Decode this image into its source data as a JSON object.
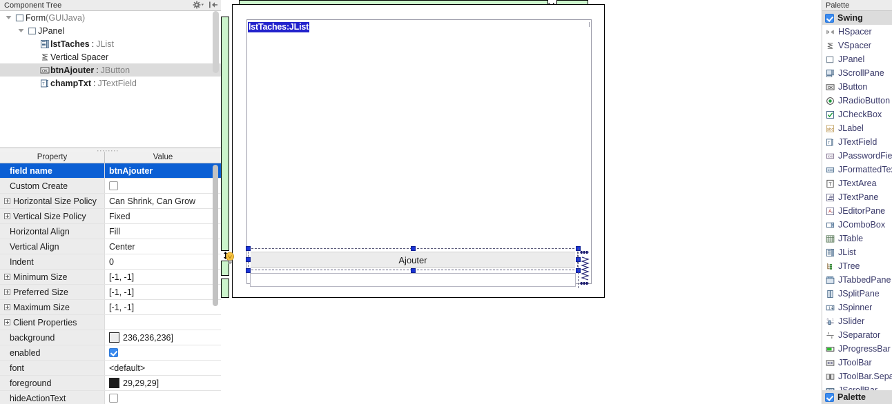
{
  "component_tree": {
    "title": "Component Tree",
    "tools": [
      {
        "name": "gear-dropdown-icon",
        "label": "Settings"
      },
      {
        "name": "collapse-all-icon",
        "label": "Collapse All"
      }
    ],
    "rows": [
      {
        "depth": 0,
        "twisty": "expanded",
        "icon": "form-icon",
        "name": "Form",
        "sep": "",
        "cls": "(GUIJava)",
        "bold": false,
        "selected": false
      },
      {
        "depth": 1,
        "twisty": "expanded",
        "icon": "jpanel-icon",
        "name": "JPanel",
        "sep": "",
        "cls": "",
        "bold": false,
        "selected": false
      },
      {
        "depth": 2,
        "twisty": "none",
        "icon": "jlist-icon",
        "name": "lstTaches",
        "sep": ":",
        "cls": "JList",
        "bold": true,
        "selected": false
      },
      {
        "depth": 2,
        "twisty": "none",
        "icon": "vspacer-icon",
        "name": "Vertical Spacer",
        "sep": "",
        "cls": "",
        "bold": false,
        "selected": false
      },
      {
        "depth": 2,
        "twisty": "none",
        "icon": "jbutton-icon",
        "name": "btnAjouter",
        "sep": ":",
        "cls": "JButton",
        "bold": true,
        "selected": true
      },
      {
        "depth": 2,
        "twisty": "none",
        "icon": "jtextfield-icon",
        "name": "champTxt",
        "sep": ":",
        "cls": "JTextField",
        "bold": true,
        "selected": false
      }
    ]
  },
  "properties": {
    "header": {
      "property": "Property",
      "value": "Value"
    },
    "rows": [
      {
        "name": "field name",
        "value": "btnAjouter",
        "kind": "text",
        "expandable": false,
        "selected": true
      },
      {
        "name": "Custom Create",
        "value": "",
        "kind": "checkbox",
        "checked": false,
        "expandable": false,
        "selected": false
      },
      {
        "name": "Horizontal Size Policy",
        "value": "Can Shrink, Can Grow",
        "kind": "text",
        "expandable": true,
        "selected": false
      },
      {
        "name": "Vertical Size Policy",
        "value": "Fixed",
        "kind": "text",
        "expandable": true,
        "selected": false
      },
      {
        "name": "Horizontal Align",
        "value": "Fill",
        "kind": "text",
        "expandable": false,
        "selected": false
      },
      {
        "name": "Vertical Align",
        "value": "Center",
        "kind": "text",
        "expandable": false,
        "selected": false
      },
      {
        "name": "Indent",
        "value": "0",
        "kind": "text",
        "expandable": false,
        "selected": false
      },
      {
        "name": "Minimum Size",
        "value": "[-1, -1]",
        "kind": "text",
        "expandable": true,
        "selected": false
      },
      {
        "name": "Preferred Size",
        "value": "[-1, -1]",
        "kind": "text",
        "expandable": true,
        "selected": false
      },
      {
        "name": "Maximum Size",
        "value": "[-1, -1]",
        "kind": "text",
        "expandable": true,
        "selected": false
      },
      {
        "name": "Client Properties",
        "value": "",
        "kind": "text",
        "expandable": true,
        "selected": false
      },
      {
        "name": "background",
        "value": "236,236,236]",
        "kind": "color",
        "swatch": "#ececec",
        "expandable": false,
        "selected": false
      },
      {
        "name": "enabled",
        "value": "",
        "kind": "checkbox",
        "checked": true,
        "expandable": false,
        "selected": false
      },
      {
        "name": "font",
        "value": "<default>",
        "kind": "text",
        "expandable": false,
        "selected": false
      },
      {
        "name": "foreground",
        "value": "29,29,29]",
        "kind": "color",
        "swatch": "#1d1d1d",
        "expandable": false,
        "selected": false
      },
      {
        "name": "hideActionText",
        "value": "",
        "kind": "checkbox",
        "checked": false,
        "expandable": false,
        "selected": false
      }
    ]
  },
  "designer": {
    "jlist_label": "lstTaches:JList",
    "button_label": "Ajouter",
    "textfield_value": "",
    "horizontal_resize_icon": "horizontal-resize-arrow-icon",
    "vertical_resize_icon": "vertical-resize-arrow-icon",
    "intention_icon": "lightbulb-icon",
    "vspacer_icon": "vertical-spacer-spring-icon",
    "colors": {
      "ruler_fill": "#ccf5cc",
      "selection_handle": "#1b34d6",
      "label_highlight": "#2222cc"
    }
  },
  "palette": {
    "title": "Palette",
    "group": {
      "label": "Swing",
      "checked": true
    },
    "items": [
      {
        "label": "HSpacer",
        "icon": "hspacer-icon"
      },
      {
        "label": "VSpacer",
        "icon": "vspacer-icon"
      },
      {
        "label": "JPanel",
        "icon": "jpanel-icon"
      },
      {
        "label": "JScrollPane",
        "icon": "jscrollpane-icon"
      },
      {
        "label": "JButton",
        "icon": "jbutton-icon"
      },
      {
        "label": "JRadioButton",
        "icon": "jradiobutton-icon"
      },
      {
        "label": "JCheckBox",
        "icon": "jcheckbox-icon"
      },
      {
        "label": "JLabel",
        "icon": "jlabel-icon"
      },
      {
        "label": "JTextField",
        "icon": "jtextfield-icon"
      },
      {
        "label": "JPasswordField",
        "icon": "jpasswordfield-icon"
      },
      {
        "label": "JFormattedTextField",
        "icon": "jformattedtextfield-icon"
      },
      {
        "label": "JTextArea",
        "icon": "jtextarea-icon"
      },
      {
        "label": "JTextPane",
        "icon": "jtextpane-icon"
      },
      {
        "label": "JEditorPane",
        "icon": "jeditorpane-icon"
      },
      {
        "label": "JComboBox",
        "icon": "jcombobox-icon"
      },
      {
        "label": "JTable",
        "icon": "jtable-icon"
      },
      {
        "label": "JList",
        "icon": "jlist-icon"
      },
      {
        "label": "JTree",
        "icon": "jtree-icon"
      },
      {
        "label": "JTabbedPane",
        "icon": "jtabbedpane-icon"
      },
      {
        "label": "JSplitPane",
        "icon": "jsplitpane-icon"
      },
      {
        "label": "JSpinner",
        "icon": "jspinner-icon"
      },
      {
        "label": "JSlider",
        "icon": "jslider-icon"
      },
      {
        "label": "JSeparator",
        "icon": "jseparator-icon"
      },
      {
        "label": "JProgressBar",
        "icon": "jprogressbar-icon"
      },
      {
        "label": "JToolBar",
        "icon": "jtoolbar-icon"
      },
      {
        "label": "JToolBar.Separator",
        "icon": "jtoolbar-separator-icon"
      },
      {
        "label": "JScrollBar",
        "icon": "jscrollbar-icon"
      }
    ],
    "bottom_group": {
      "label": "Palette",
      "checked": true
    }
  }
}
